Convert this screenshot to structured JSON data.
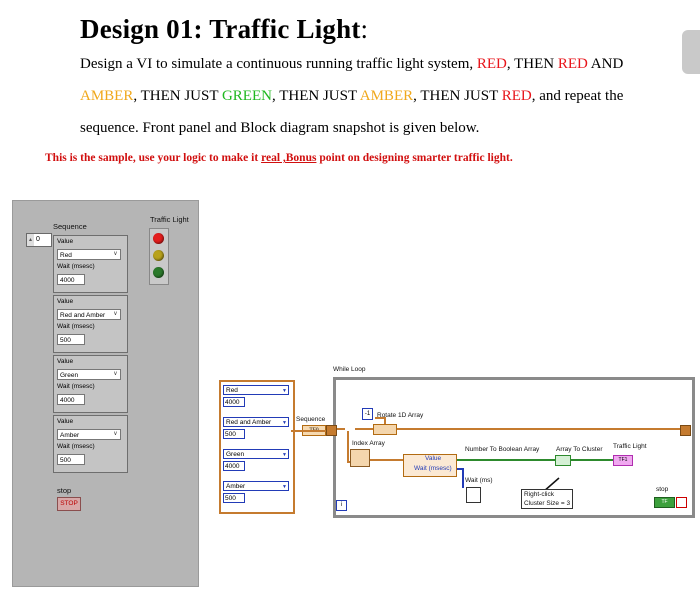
{
  "doc": {
    "title_main": "Design 01: Traffic Light",
    "title_colon": ":",
    "p1": {
      "a": "Design a VI to simulate a continuous running traffic light system, ",
      "b": "RED",
      "c": ", THEN ",
      "d": "RED",
      "e": " AND"
    },
    "p2": {
      "a": "AMBER",
      "b": ", THEN JUST ",
      "c": "GREEN",
      "d": ", THEN JUST ",
      "e": "AMBER",
      "f": ", THEN JUST ",
      "g": "RED",
      "h": ", and repeat the"
    },
    "p3": "sequence. Front panel and Block diagram snapshot is given below.",
    "sample": {
      "a": "This is the sample, use your logic to make it ",
      "b": "real ,Bonus",
      "c": " point on designing smarter traffic light."
    }
  },
  "front_panel": {
    "sequence_label": "Sequence",
    "index_value": "0",
    "traffic_light_label": "Traffic Light",
    "clusters": [
      {
        "value_label": "Value",
        "value": "Red",
        "wait_label": "Wait (msesc)",
        "wait": "4000"
      },
      {
        "value_label": "Value",
        "value": "Red and Amber",
        "wait_label": "Wait (msesc)",
        "wait": "500"
      },
      {
        "value_label": "Value",
        "value": "Green",
        "wait_label": "Wait (msesc)",
        "wait": "4000"
      },
      {
        "value_label": "Value",
        "value": "Amber",
        "wait_label": "Wait (msesc)",
        "wait": "500"
      }
    ],
    "stop_label": "stop",
    "stop_button": "STOP",
    "lamp_colors": [
      "#e41e1e",
      "#b8a21c",
      "#2b7a2b"
    ]
  },
  "block_diagram": {
    "constants": [
      {
        "state": "Red",
        "ms": "4000"
      },
      {
        "state": "Red and Amber",
        "ms": "500"
      },
      {
        "state": "Green",
        "ms": "4000"
      },
      {
        "state": "Amber",
        "ms": "500"
      }
    ],
    "while_loop_label": "While Loop",
    "sequence_label": "Sequence",
    "rotate_label": "Rotate 1D Array",
    "rotate_const": "-1",
    "index_array_label": "Index Array",
    "unbundle_value": "Value",
    "unbundle_wait": "Wait (msesc)",
    "num_to_bool_label": "Number To Boolean Array",
    "array_to_cluster_label": "Array To Cluster",
    "traffic_light_label": "Traffic Light",
    "wait_label": "Wait (ms)",
    "note_line1": "Right-click",
    "note_line2": "Cluster Size = 3",
    "stop_label": "stop",
    "iteration_label": "i",
    "seq_terminal": "TF0",
    "tl_terminal": "TF1",
    "stop_terminal": "TF"
  }
}
